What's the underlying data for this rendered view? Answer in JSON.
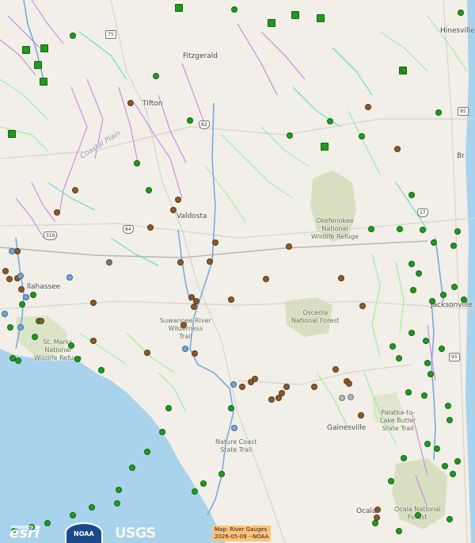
{
  "colors": {
    "land": "#f1efe8",
    "water": "#a9d3ec",
    "park": "#d7dfc0",
    "major_river": "#7ba9e0",
    "minor_river_a": "#8cf08c",
    "minor_river_b": "#c77ae0",
    "minor_river_c": "#4fd7d0",
    "status": {
      "green": "#1f9a1f",
      "brown": "#8a5a2a",
      "blue": "#6ea6dc",
      "gray": "#777777",
      "gray_light": "#b5b5b5"
    }
  },
  "places": {
    "fitzgerald": "Fitzgerald",
    "tifton": "Tifton",
    "hinesville": "Hinesville",
    "brunswick": "Br",
    "valdosta": "Valdosta",
    "tallahassee": "llahassee",
    "jacksonville": "Jacksonville",
    "gainesville": "Gainesville",
    "ocala": "Ocala",
    "coastal_plain": "Coastal Plain",
    "okefenokee": "Okefenokee\nNational\nWildlife Refuge",
    "osceola": "Osceola\nNational Forest",
    "suwannee": "Suwannee River\nWilderness\nTrail",
    "st_marks": "St. Marks\nNational\nWildlife Refuge",
    "nature_coast": "Nature Coast\nState Trail",
    "palatka": "Palatka-to-\nLake Butler\nState Trail",
    "ocala_nf": "Ocala National\nForest"
  },
  "shields": {
    "i75": "75",
    "us82": "82",
    "us84": "84",
    "us319": "319",
    "us17": "17",
    "i95": "95",
    "i95b": "95"
  },
  "logos": {
    "esri_small": "POWERED BY",
    "esri": "esri",
    "noaa": "NOAA",
    "usgs": "USGS"
  },
  "attribution": {
    "line1": "Map: River Gauges",
    "line2": "2026-05-09 --NOAA"
  }
}
